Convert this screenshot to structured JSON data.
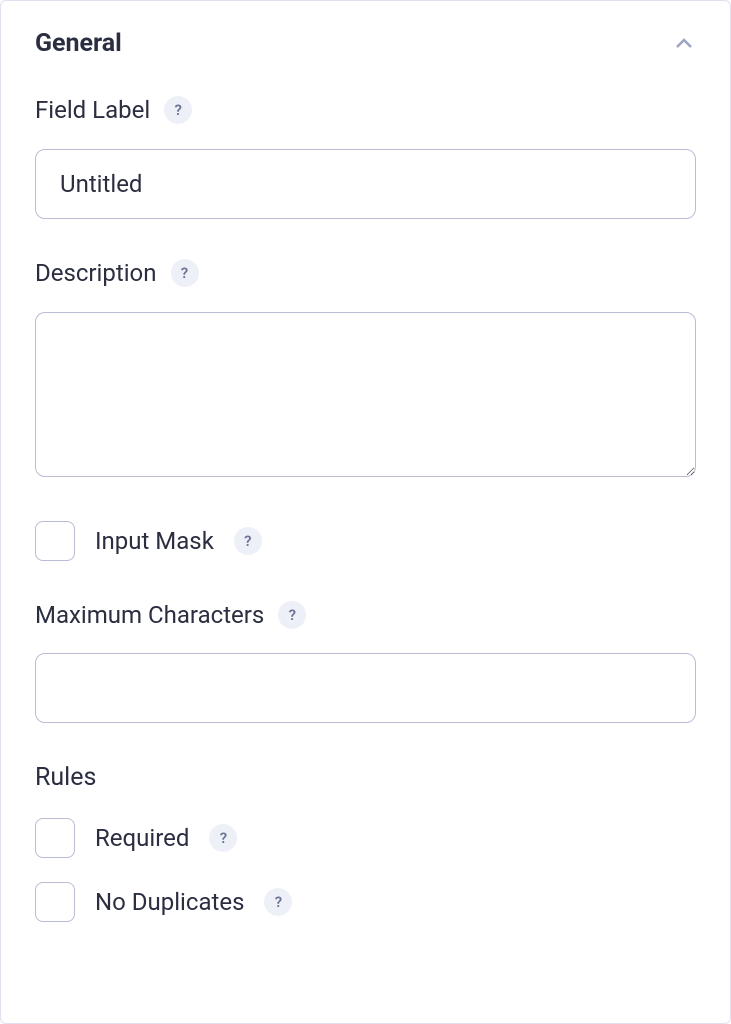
{
  "panel": {
    "title": "General"
  },
  "fields": {
    "fieldLabel": {
      "label": "Field Label",
      "value": "Untitled"
    },
    "description": {
      "label": "Description",
      "value": ""
    },
    "inputMask": {
      "label": "Input Mask",
      "checked": false
    },
    "maxCharacters": {
      "label": "Maximum Characters",
      "value": ""
    }
  },
  "rules": {
    "heading": "Rules",
    "items": {
      "required": {
        "label": "Required",
        "checked": false
      },
      "noDuplicates": {
        "label": "No Duplicates",
        "checked": false
      }
    }
  },
  "helpGlyph": "?"
}
